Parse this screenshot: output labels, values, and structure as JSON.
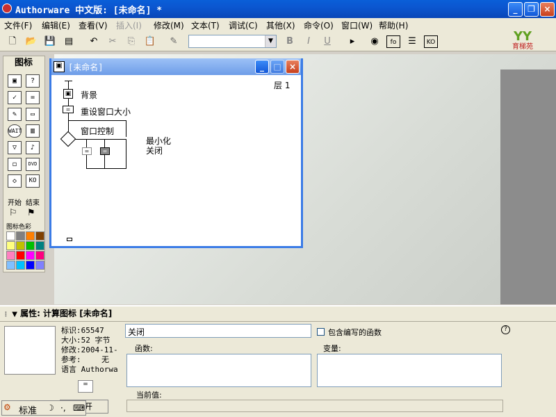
{
  "window": {
    "title": "Authorware 中文版: [未命名] *"
  },
  "menu": [
    "文件(F)",
    "编辑(E)",
    "查看(V)",
    "插入(I)",
    "修改(M)",
    "文本(T)",
    "调试(C)",
    "其他(X)",
    "命令(O)",
    "窗口(W)",
    "帮助(H)"
  ],
  "toolbar": {
    "style_value": "",
    "bold": "B",
    "italic": "I",
    "underline": "U"
  },
  "logo": {
    "text": "育梯苑"
  },
  "palette": {
    "title": "图标",
    "start_label": "开始",
    "end_label": "结束",
    "color_label": "图标色彩",
    "colors": [
      "#ffffff",
      "#808080",
      "#ff8000",
      "#804000",
      "#ffff80",
      "#c0c000",
      "#00c000",
      "#008080",
      "#ff80c0",
      "#ff0000",
      "#ff00ff",
      "#ff0080",
      "#80c0ff",
      "#00c0ff",
      "#0000ff",
      "#8080ff"
    ]
  },
  "flow_window": {
    "title": "[未命名]",
    "level": "层 1",
    "nodes": {
      "background": "背景",
      "resize": "重设窗口大小",
      "window_control": "窗口控制",
      "minimize": "最小化",
      "close": "关闭"
    }
  },
  "properties": {
    "header": "属性: 计算图标 [未命名]",
    "id_label": "标识:65547",
    "size_label": "大小:52 字节",
    "modified_label": "修改:2004-11-",
    "ref_label": "参考:",
    "ref_value": "无",
    "lang_label": "语言 Authorwa",
    "name_value": "关闭",
    "include_label": "包含编写的函数",
    "functions_label": "函数:",
    "variables_label": "变量:",
    "current_value_label": "当前值:",
    "open_button": "打开"
  },
  "ime": {
    "mode": "标准"
  }
}
